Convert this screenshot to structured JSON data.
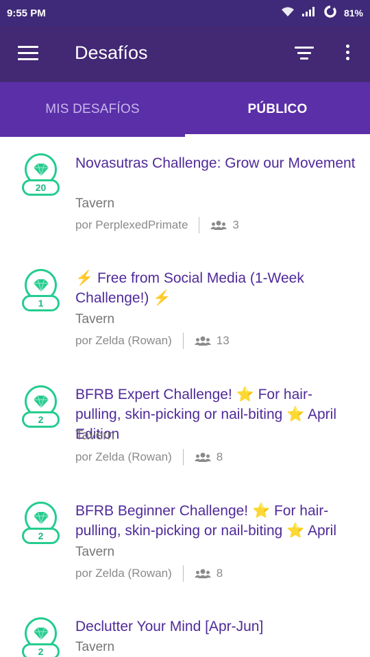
{
  "status_bar": {
    "time": "9:55 PM",
    "battery_pct": "81%",
    "icons": [
      "wifi-icon",
      "signal-icon",
      "battery-ring-icon"
    ]
  },
  "app_bar": {
    "title": "Desafíos",
    "icons": [
      "menu-icon",
      "filter-icon",
      "more-vert-icon"
    ]
  },
  "tabs": [
    {
      "label": "MIS DESAFÍOS",
      "active": false
    },
    {
      "label": "PÚBLICO",
      "active": true
    }
  ],
  "challenges": [
    {
      "badge_count": "20",
      "title": "Novasutras Challenge: Grow our Movement",
      "group": "Tavern",
      "author": "por PerplexedPrimate",
      "members": "3"
    },
    {
      "badge_count": "1",
      "title": "⚡ Free from Social Media (1-Week Challenge!) ⚡",
      "group": "Tavern",
      "author": "por Zelda (Rowan)",
      "members": "13"
    },
    {
      "badge_count": "2",
      "title": "BFRB Expert Challenge! ⭐ For hair-pulling, skin-picking or nail-biting ⭐ April Edition",
      "group": "Tavern",
      "author": "por Zelda (Rowan)",
      "members": "8"
    },
    {
      "badge_count": "2",
      "title": "BFRB Beginner Challenge! ⭐ For hair-pulling, skin-picking or nail-biting ⭐ April",
      "group": "Tavern",
      "author": "por Zelda (Rowan)",
      "members": "8"
    },
    {
      "badge_count": "2",
      "title": "Declutter Your Mind [Apr-Jun]",
      "group": "Tavern"
    }
  ],
  "colors": {
    "status_bar": "#3f2a79",
    "app_bar": "#432874",
    "tabs": "#5a2fa7",
    "title_text": "#4f2a99",
    "badge": "#24cc8f"
  }
}
